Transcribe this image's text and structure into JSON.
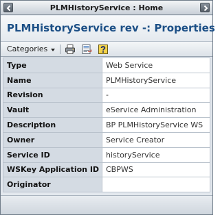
{
  "window": {
    "title": "PLMHistoryService : Home"
  },
  "header": {
    "page_title": "PLMHistoryService rev -: Properties"
  },
  "toolbar": {
    "categories_label": "Categories",
    "icons": [
      "print-icon",
      "export-icon",
      "help-icon"
    ]
  },
  "properties": [
    {
      "label": "Type",
      "value": "Web Service"
    },
    {
      "label": "Name",
      "value": "PLMHistoryService"
    },
    {
      "label": "Revision",
      "value": "-"
    },
    {
      "label": "Vault",
      "value": "eService Administration"
    },
    {
      "label": "Description",
      "value": "BP PLMHistoryService WS"
    },
    {
      "label": "Owner",
      "value": "Service Creator"
    },
    {
      "label": "Service ID",
      "value": "historyService"
    },
    {
      "label": "WSKey Application ID",
      "value": "CBPWS"
    },
    {
      "label": "Originator",
      "value": ""
    }
  ],
  "colors": {
    "title_blue": "#1c4f86",
    "label_bg": "#d4dbe3",
    "border": "#b9c2cc"
  }
}
